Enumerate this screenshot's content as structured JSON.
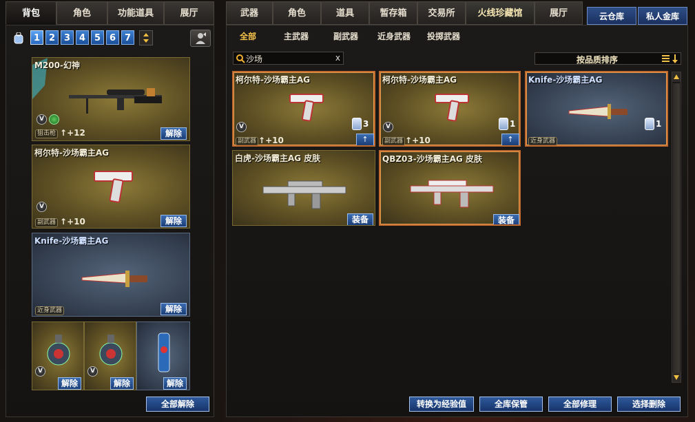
{
  "left_tabs": [
    "背包",
    "角色",
    "功能道具",
    "展厅"
  ],
  "right_tabs": [
    "武器",
    "角色",
    "道具",
    "暂存箱",
    "交易所",
    "火线珍藏馆",
    "展厅"
  ],
  "side_tabs": [
    "云仓库",
    "私人金库"
  ],
  "bag_pages": [
    "1",
    "2",
    "3",
    "4",
    "5",
    "6",
    "7"
  ],
  "sub_tabs": [
    "全部",
    "主武器",
    "副武器",
    "近身武器",
    "投掷武器"
  ],
  "search": {
    "value": "沙场",
    "clear": "x"
  },
  "sort": {
    "label": "按品质排序"
  },
  "equipped": [
    {
      "title": "M200-幻神",
      "category": "狙击枪",
      "level": "+12",
      "action": "解除"
    },
    {
      "title": "柯尔特-沙场霸主AG",
      "category": "副武器",
      "level": "+10",
      "action": "解除"
    },
    {
      "title": "Knife-沙场霸主AG",
      "category": "近身武器",
      "level": "",
      "action": "解除"
    }
  ],
  "throwables": [
    {
      "action": "解除"
    },
    {
      "action": "解除"
    },
    {
      "action": "解除"
    }
  ],
  "unequip_all": "全部解除",
  "inventory": [
    {
      "title": "柯尔特-沙场霸主AG",
      "category": "副武器",
      "level": "+10",
      "count": "3"
    },
    {
      "title": "柯尔特-沙场霸主AG",
      "category": "副武器",
      "level": "+10",
      "count": "1"
    },
    {
      "title": "Knife-沙场霸主AG",
      "category": "近身武器",
      "level": "",
      "count": "1"
    },
    {
      "title": "白虎-沙场霸主AG 皮肤",
      "action": "装备"
    },
    {
      "title": "QBZ03-沙场霸主AG 皮肤",
      "action": "装备"
    }
  ],
  "bottom_buttons": [
    "转换为经验值",
    "全库保管",
    "全部修理",
    "选择删除"
  ],
  "colors": {
    "accent_blue": "#2f5a9c",
    "gold_card": "#8d7a38",
    "blue_card": "#55657a",
    "selected_border": "#c06a30"
  }
}
